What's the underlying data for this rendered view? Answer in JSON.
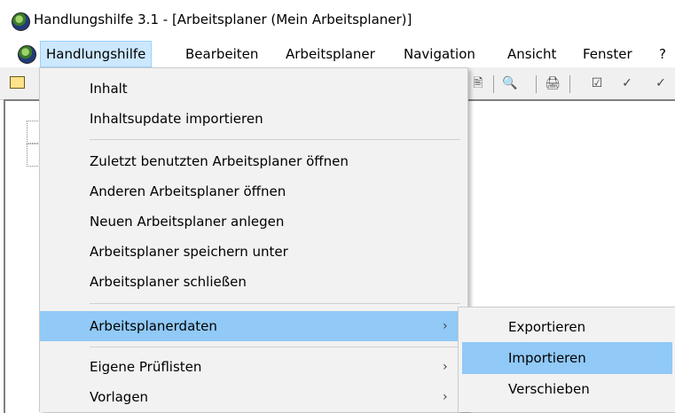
{
  "window": {
    "title": "Handlungshilfe 3.1 - [Arbeitsplaner (Mein Arbeitsplaner)]"
  },
  "menubar": {
    "items": [
      "Handlungshilfe",
      "Bearbeiten",
      "Arbeitsplaner",
      "Navigation",
      "Ansicht",
      "Fenster",
      "?"
    ],
    "open_item": "Handlungshilfe"
  },
  "toolbar": {
    "glyphs": [
      "🖹",
      "🔍",
      "🖨",
      "☑",
      "✓",
      "✓"
    ]
  },
  "dropdown": {
    "items": [
      {
        "label": "Inhalt"
      },
      {
        "label": "Inhaltsupdate importieren"
      },
      {
        "label": "Zuletzt benutzten Arbeitsplaner öffnen"
      },
      {
        "label": "Anderen Arbeitsplaner öffnen"
      },
      {
        "label": "Neuen Arbeitsplaner anlegen"
      },
      {
        "label": "Arbeitsplaner speichern unter"
      },
      {
        "label": "Arbeitsplaner schließen"
      },
      {
        "label": "Arbeitsplanerdaten",
        "arrow": "›",
        "highlighted": true
      },
      {
        "label": "Eigene Prüflisten",
        "arrow": "›"
      },
      {
        "label": "Vorlagen",
        "arrow": "›"
      }
    ]
  },
  "submenu": {
    "items": [
      {
        "label": "Exportieren"
      },
      {
        "label": "Importieren",
        "highlighted": true
      },
      {
        "label": "Verschieben"
      }
    ]
  },
  "colors": {
    "menu_highlight": "#91c9f7",
    "menubar_open": "#cce8ff",
    "menu_background": "#f2f2f2"
  }
}
